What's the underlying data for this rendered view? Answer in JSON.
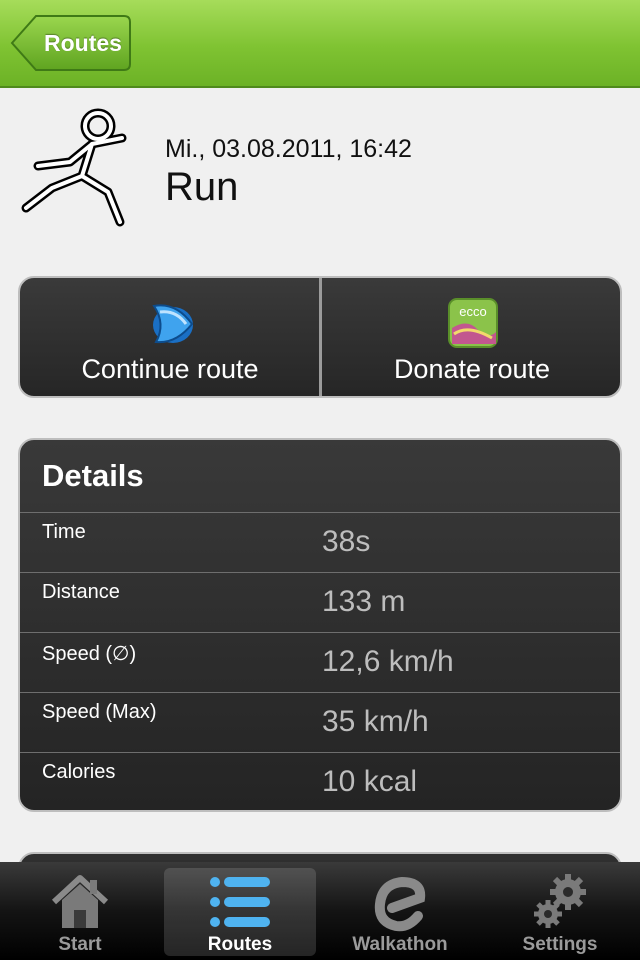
{
  "navbar": {
    "back_label": "Routes"
  },
  "header": {
    "date": "Mi., 03.08.2011, 16:42",
    "title": "Run",
    "icon": "runner-icon"
  },
  "actions": [
    {
      "label": "Continue route",
      "icon": "continue-route-icon"
    },
    {
      "label": "Donate route",
      "icon": "ecco-donate-icon",
      "icon_text": "ecco"
    }
  ],
  "details": {
    "title": "Details",
    "rows": [
      {
        "label": "Time",
        "value": "38s"
      },
      {
        "label": "Distance",
        "value": "133 m"
      },
      {
        "label": "Speed (∅)",
        "value": "12,6 km/h"
      },
      {
        "label": "Speed (Max)",
        "value": "35 km/h"
      },
      {
        "label": "Calories",
        "value": "10 kcal"
      }
    ]
  },
  "tabbar": {
    "active": "Routes",
    "tabs": [
      {
        "label": "Start",
        "icon": "home-icon"
      },
      {
        "label": "Routes",
        "icon": "list-icon"
      },
      {
        "label": "Walkathon",
        "icon": "walkathon-e-icon"
      },
      {
        "label": "Settings",
        "icon": "gears-icon"
      }
    ]
  },
  "colors": {
    "accent": "#7fc332",
    "panel": "#2c2c2c",
    "background": "#f0f0f0"
  }
}
